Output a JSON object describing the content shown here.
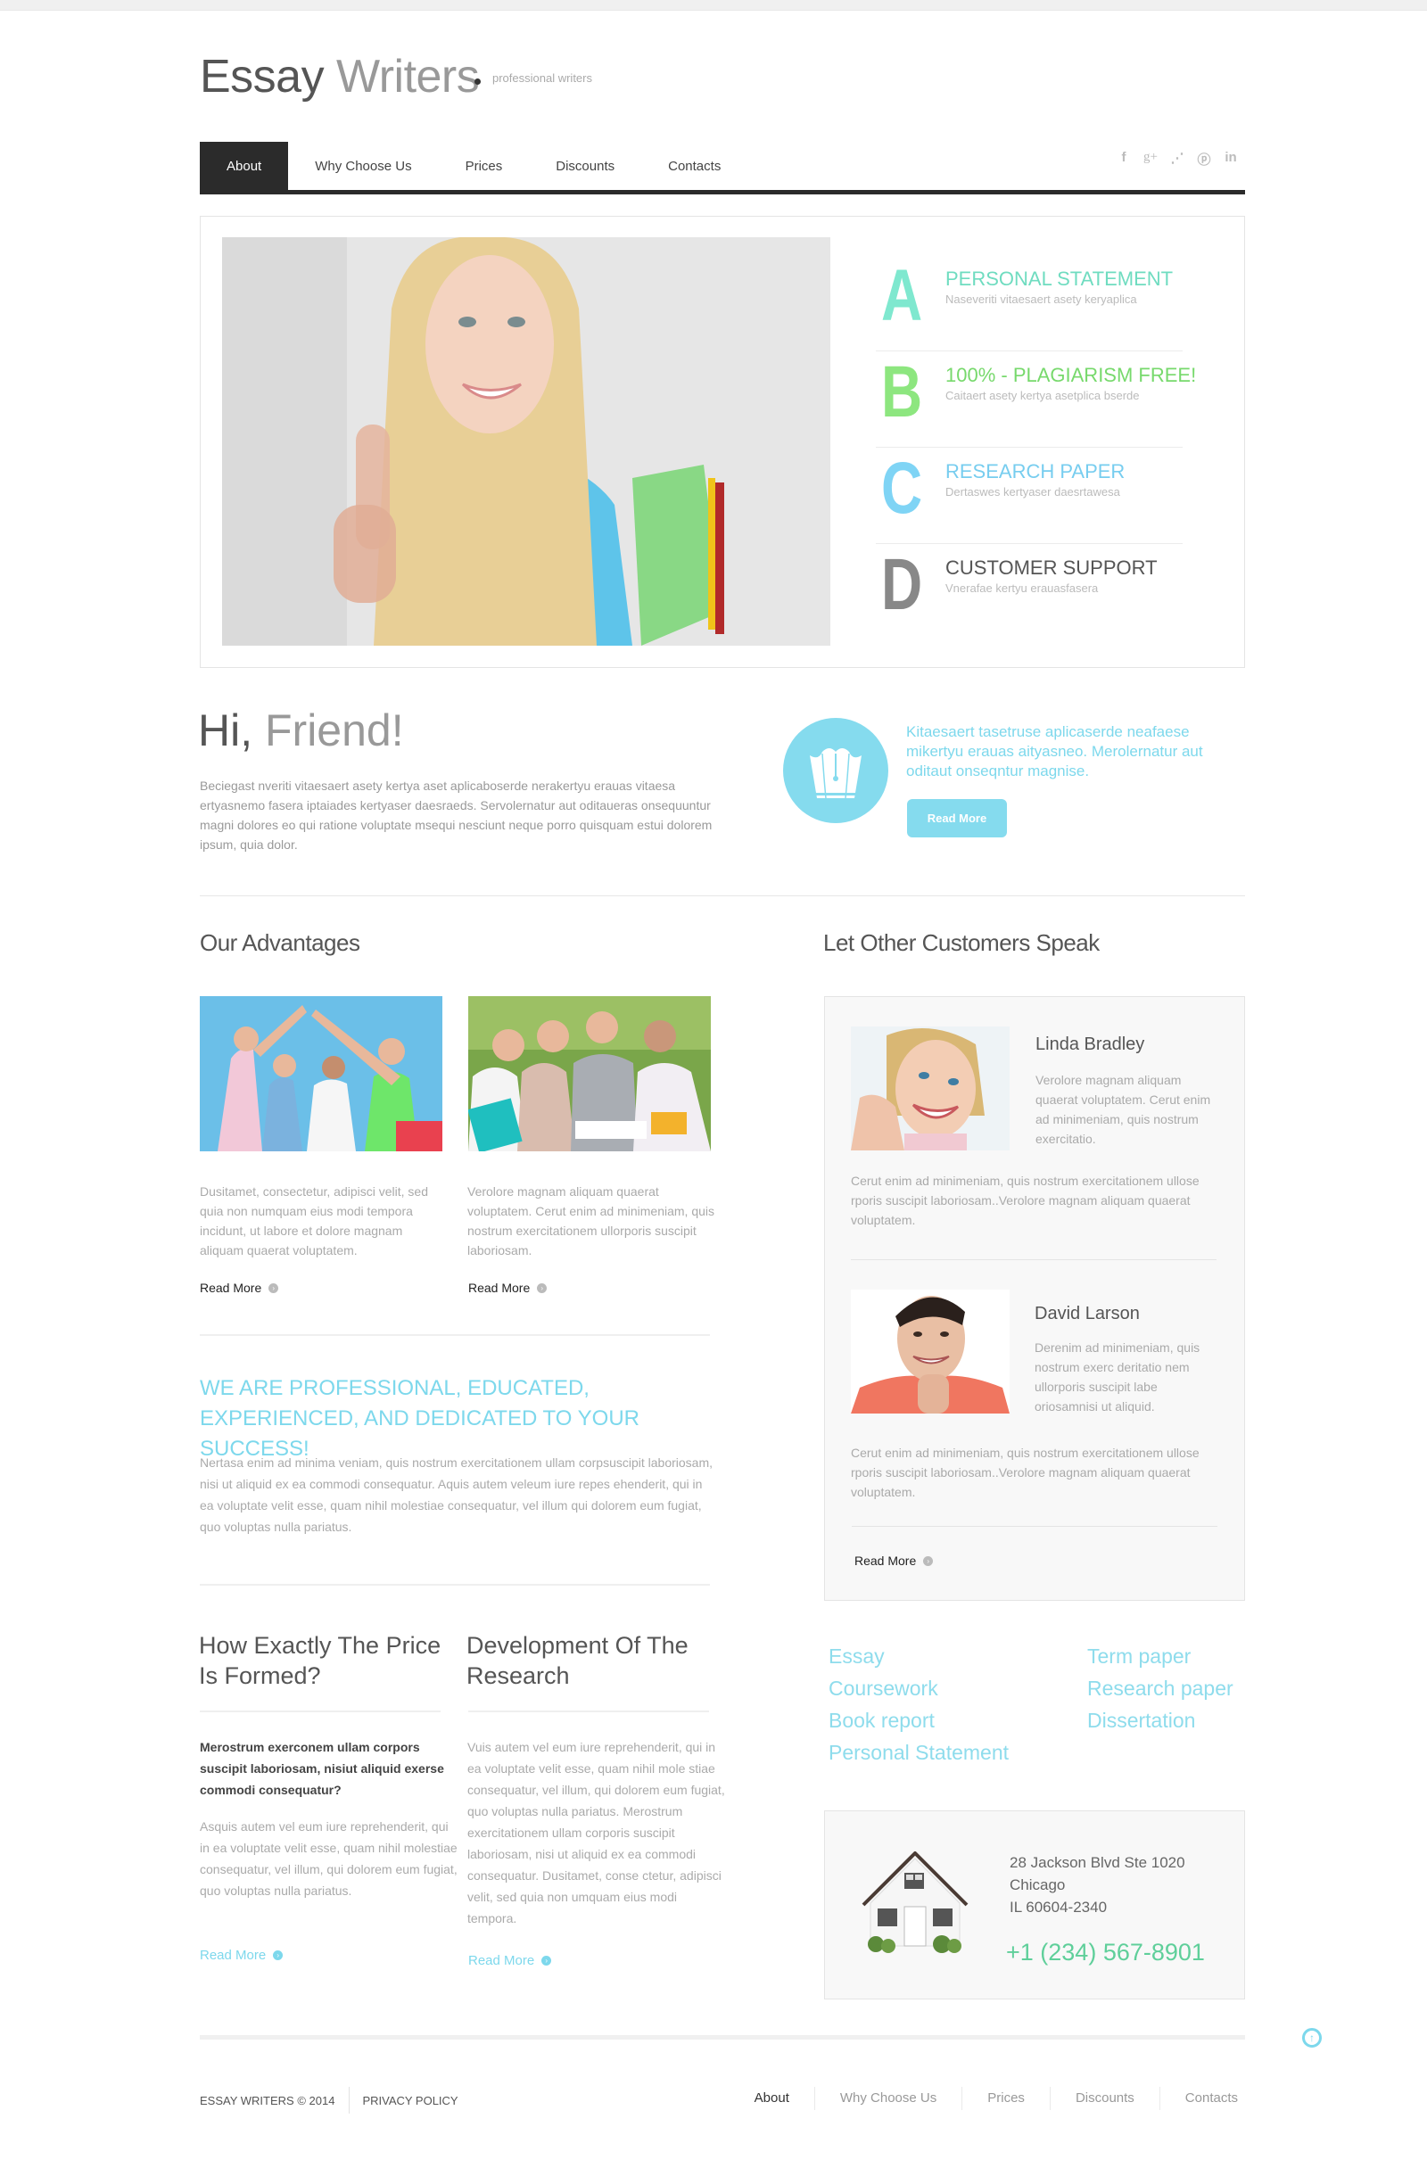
{
  "header": {
    "logo_dark": "Essay",
    "logo_light": " Writers",
    "tagline": "professional writers"
  },
  "nav": {
    "items": [
      {
        "label": "About",
        "active": true
      },
      {
        "label": "Why Choose Us"
      },
      {
        "label": "Prices"
      },
      {
        "label": "Discounts"
      },
      {
        "label": "Contacts"
      }
    ]
  },
  "social": [
    {
      "icon": "facebook-icon",
      "glyph": "f"
    },
    {
      "icon": "google-plus-icon",
      "glyph": "g+"
    },
    {
      "icon": "rss-icon",
      "glyph": "⋰"
    },
    {
      "icon": "pinterest-icon",
      "glyph": "ⓟ"
    },
    {
      "icon": "linkedin-icon",
      "glyph": "in"
    }
  ],
  "features": [
    {
      "letter": "A",
      "title": "PERSONAL STATEMENT",
      "subtitle": "Naseveriti vitaesaert asety keryaplica",
      "color": "#7fe8cf",
      "title_color": "#6fdcc0"
    },
    {
      "letter": "B",
      "title": "100% - PLAGIARISM FREE!",
      "subtitle": "Caitaert asety kertya asetplica bserde",
      "color": "#8de67f",
      "title_color": "#77d96c"
    },
    {
      "letter": "C",
      "title": "RESEARCH PAPER",
      "subtitle": "Dertaswes kertyaser daesrtawesa",
      "color": "#7fd4f5",
      "title_color": "#77cdef"
    },
    {
      "letter": "D",
      "title": "CUSTOMER SUPPORT",
      "subtitle": "Vnerafae kertyu erauasfasera",
      "color": "#888888",
      "title_color": "#555555"
    }
  ],
  "hi": {
    "title_dark": "Hi,",
    "title_light": " Friend!",
    "text": "Beciegast nveriti vitaesaert asety kertya aset aplicaboserde nerakertyu erauas vitaesa ertyasnemo fasera iptaiades kertyaser daesraeds. Servolernatur aut oditaueras onsequuntur magni dolores eo qui ratione voluptate msequi nesciunt neque porro quisquam estui dolorem ipsum, quia dolor.",
    "promo_text": "Kitaesaert tasetruse aplicaserde neafaese mikertyu erauas aityasneo. Merolernatur aut oditaut onseqntur magnise.",
    "promo_button": "Read More"
  },
  "advantages": {
    "heading": "Our Advantages",
    "items": [
      {
        "text": "Dusitamet, consectetur, adipisci velit, sed quia non numquam eius modi tempora incidunt, ut labore et dolore magnam aliquam quaerat voluptatem.",
        "link": "Read More"
      },
      {
        "text": "Verolore magnam aliquam quaerat voluptatem. Cerut enim ad minimeniam, quis nostrum exercitationem ullorporis suscipit laboriosam.",
        "link": "Read More"
      }
    ]
  },
  "professional": {
    "heading": "WE ARE PROFESSIONAL, EDUCATED, EXPERIENCED, AND DEDICATED TO YOUR SUCCESS!",
    "text": "Nertasa enim ad minima veniam, quis nostrum exercitationem ullam corpsuscipit laboriosam, nisi ut aliquid ex ea commodi consequatur. Aquis autem veleum iure repes ehenderit, qui in ea voluptate velit esse, quam nihil molestiae consequatur, vel illum qui dolorem eum fugiat, quo voluptas nulla pariatus."
  },
  "columns": [
    {
      "heading": "How Exactly The Price Is Formed?",
      "bold": "Merostrum exerconem ullam corpors suscipit laboriosam, nisiut aliquid exerse commodi consequatur?",
      "text": "Asquis autem vel eum iure reprehenderit, qui in ea voluptate velit esse, quam nihil molestiae consequatur, vel illum, qui dolorem eum fugiat, quo voluptas nulla pariatus.",
      "link": "Read More"
    },
    {
      "heading": "Development Of The Research",
      "text": "Vuis autem vel eum iure reprehenderit, qui in ea voluptate velit esse, quam nihil mole stiae consequatur, vel illum, qui dolorem eum fugiat, quo voluptas nulla pariatus. Merostrum exercitationem ullam corporis suscipit laboriosam, nisi ut aliquid ex ea commodi consequatur. Dusitamet, conse ctetur, adipisci velit, sed quia non umquam eius modi tempora.",
      "link": "Read More"
    }
  ],
  "testimonials": {
    "heading": "Let Other Customers Speak",
    "items": [
      {
        "name": "Linda Bradley",
        "short": "Verolore magnam aliquam quaerat voluptatem. Cerut enim ad minimeniam, quis nostrum exercitatio.",
        "long": "Cerut enim ad minimeniam, quis nostrum exercitationem ullose rporis suscipit laboriosam..Verolore magnam aliquam quaerat voluptatem."
      },
      {
        "name": "David Larson",
        "short": "Derenim ad minimeniam, quis nostrum exerc deritatio nem ullorporis suscipit labe oriosamnisi ut aliquid.",
        "long": "Cerut enim ad minimeniam, quis nostrum exercitationem ullose rporis suscipit laboriosam..Verolore magnam aliquam quaerat voluptatem."
      }
    ],
    "link": "Read More"
  },
  "services": {
    "left": [
      "Essay",
      "Coursework",
      "Book report",
      "Personal Statement"
    ],
    "right": [
      "Term paper",
      "Research paper",
      "Dissertation"
    ]
  },
  "contact": {
    "address_line1": "28 Jackson Blvd Ste 1020",
    "address_line2": "Chicago",
    "address_line3": "IL 60604-2340",
    "phone": "+1 (234) 567-8901"
  },
  "footer": {
    "copyright": "ESSAY WRITERS © 2014",
    "privacy": "PRIVACY POLICY",
    "nav": [
      "About",
      "Why Choose Us",
      "Prices",
      "Discounts",
      "Contacts"
    ],
    "to_top": "↑"
  },
  "colors": {
    "accent": "#7dd8ec",
    "dark": "#2b2b2b",
    "phone": "#5fcf9a"
  }
}
